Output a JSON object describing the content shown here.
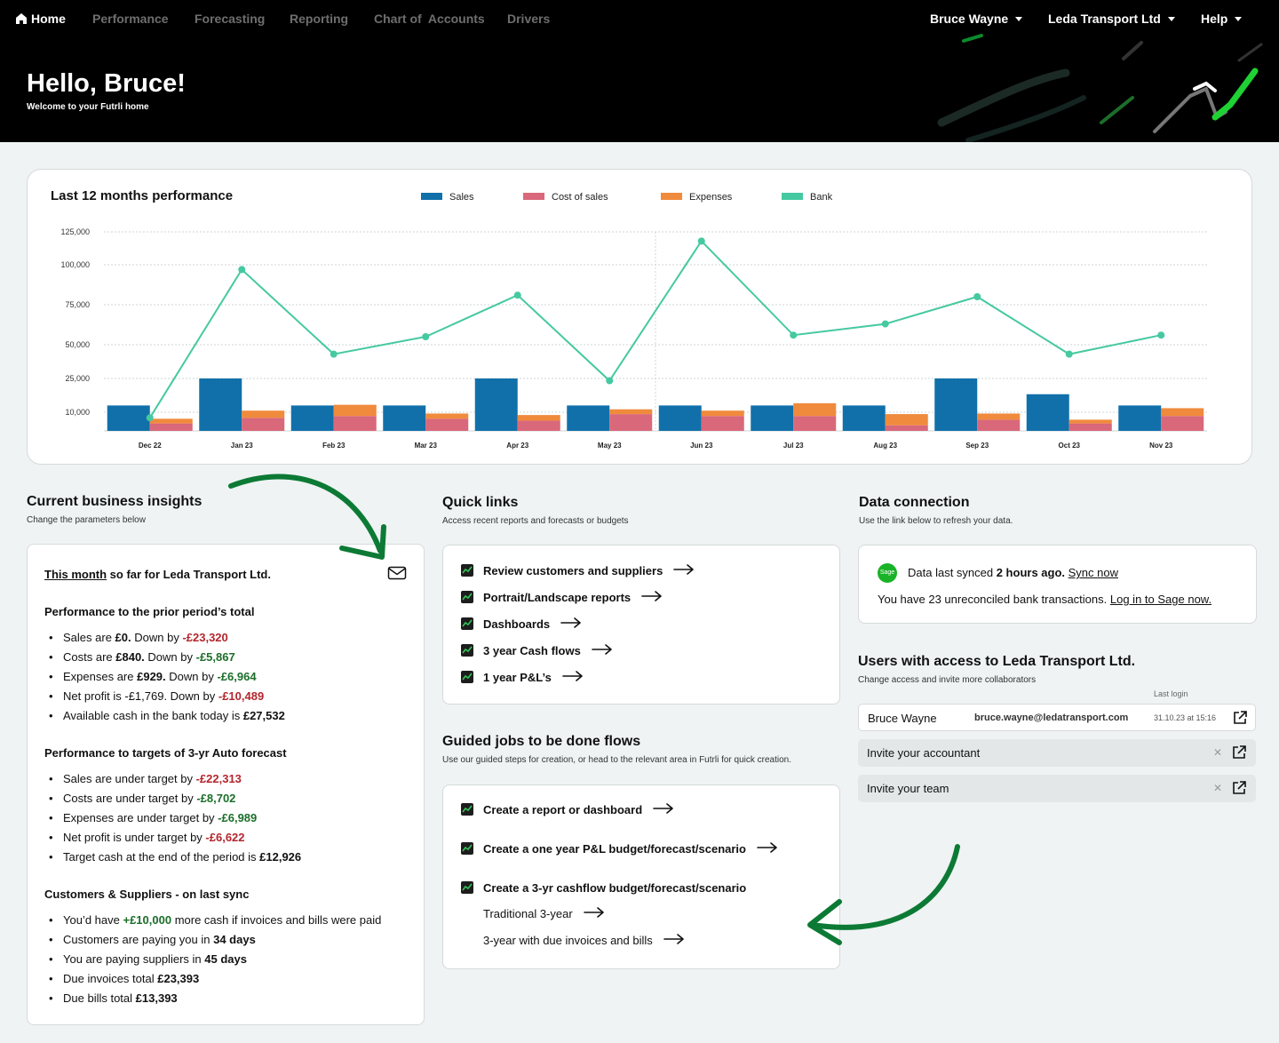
{
  "nav": {
    "home": "Home",
    "items": [
      "Performance",
      "Forecasting",
      "Reporting",
      "Chart of  Accounts",
      "Drivers"
    ],
    "user": "Bruce Wayne",
    "company": "Leda Transport Ltd",
    "help": "Help"
  },
  "hero": {
    "title": "Hello, Bruce!",
    "subtitle": "Welcome to your Futrli home"
  },
  "chart": {
    "title": "Last 12 months performance",
    "legend": [
      "Sales",
      "Cost of sales",
      "Expenses",
      "Bank"
    ],
    "colors": {
      "sales": "#1170aa",
      "cost_of_sales": "#d9687a",
      "expenses": "#f08a3c",
      "bank": "#45c9a0"
    }
  },
  "chart_data": {
    "type": "bar",
    "categories": [
      "Dec 22",
      "Jan 23",
      "Feb 23",
      "Mar 23",
      "Apr 23",
      "May 23",
      "Jun 23",
      "Jul 23",
      "Aug 23",
      "Sep 23",
      "Oct 23",
      "Nov 23"
    ],
    "y_ticks": [
      "125,000",
      "100,000",
      "75,000",
      "50,000",
      "25,000",
      "10,000"
    ],
    "series": [
      {
        "name": "Sales",
        "type": "bar",
        "values": [
          13000,
          25000,
          13000,
          13000,
          25000,
          13000,
          13000,
          13000,
          13000,
          25000,
          18000,
          13000
        ]
      },
      {
        "name": "Cost of sales",
        "type": "stacked-bar",
        "values": [
          4000,
          7000,
          8000,
          6500,
          5500,
          9000,
          8000,
          8000,
          3000,
          6000,
          4000,
          8000
        ]
      },
      {
        "name": "Expenses",
        "type": "stacked-bar",
        "values": [
          2500,
          3700,
          5300,
          2800,
          3000,
          2300,
          2700,
          6000,
          6000,
          3300,
          2000,
          3800
        ]
      },
      {
        "name": "Bank",
        "type": "line",
        "values": [
          7000,
          97000,
          43000,
          55000,
          81000,
          24000,
          118000,
          56000,
          63000,
          80000,
          43000,
          56000
        ]
      }
    ],
    "grid": true,
    "legend_position": "top"
  },
  "insights": {
    "title": "Current business insights",
    "subtitle": "Change the parameters below",
    "head_link": "This month",
    "head_rest": " so far for Leda Transport Ltd.",
    "groups": [
      {
        "title": "Performance to the prior period’s total",
        "items": [
          {
            "pre": "Sales are ",
            "b": "£0.",
            "mid": " Down by ",
            "v": "-£23,320",
            "cls": "neg"
          },
          {
            "pre": "Costs are ",
            "b": "£840.",
            "mid": " Down by ",
            "v": "-£5,867",
            "cls": "pos"
          },
          {
            "pre": "Expenses are ",
            "b": "£929.",
            "mid": " Down by ",
            "v": "-£6,964",
            "cls": "pos"
          },
          {
            "pre": "Net profit is ",
            "b": "",
            "mid": "-£1,769. Down by ",
            "v": "-£10,489",
            "cls": "neg"
          },
          {
            "pre": "Available cash in the bank today is ",
            "b": "£27,532",
            "mid": "",
            "v": "",
            "cls": ""
          }
        ]
      },
      {
        "title": "Performance to targets of 3-yr Auto forecast",
        "items": [
          {
            "pre": "Sales are under target by ",
            "b": "",
            "mid": "",
            "v": "-£22,313",
            "cls": "neg"
          },
          {
            "pre": "Costs are under target by ",
            "b": "",
            "mid": "",
            "v": "-£8,702",
            "cls": "pos"
          },
          {
            "pre": "Expenses are under target by ",
            "b": "",
            "mid": "",
            "v": "-£6,989",
            "cls": "pos"
          },
          {
            "pre": "Net profit is under target by ",
            "b": "",
            "mid": "",
            "v": "-£6,622",
            "cls": "neg"
          },
          {
            "pre": "Target cash at the end of the period is ",
            "b": "£12,926",
            "mid": "",
            "v": "",
            "cls": ""
          }
        ]
      },
      {
        "title": "Customers & Suppliers - on last sync",
        "items": [
          {
            "pre": "You’d have ",
            "b": "",
            "mid": "",
            "v": "+£10,000",
            "cls": "pos",
            "post": " more cash if invoices and bills were paid"
          },
          {
            "pre": "Customers are paying you in ",
            "b": "34 days",
            "mid": "",
            "v": "",
            "cls": ""
          },
          {
            "pre": "You are paying suppliers in ",
            "b": "45 days",
            "mid": "",
            "v": "",
            "cls": ""
          },
          {
            "pre": "Due invoices total ",
            "b": "£23,393",
            "mid": "",
            "v": "",
            "cls": ""
          },
          {
            "pre": "Due bills total ",
            "b": "£13,393",
            "mid": "",
            "v": "",
            "cls": ""
          }
        ]
      }
    ]
  },
  "quick_links": {
    "title": "Quick links",
    "subtitle": "Access recent reports and forecasts or budgets",
    "items": [
      "Review customers and suppliers",
      "Portrait/Landscape reports",
      "Dashboards",
      "3 year Cash flows",
      "1 year P&L’s"
    ]
  },
  "guided": {
    "title": "Guided jobs to be done flows",
    "subtitle": "Use our guided steps for creation, or head to the relevant area in Futrli for quick creation.",
    "items": [
      "Create a report or dashboard",
      "Create a one year P&L budget/forecast/scenario",
      "Create a 3-yr cashflow budget/forecast/scenario"
    ],
    "sub_items": [
      "Traditional 3-year",
      "3-year with due invoices and bills"
    ]
  },
  "data_connection": {
    "title": "Data connection",
    "subtitle": "Use the link below to refresh your data.",
    "badge": "Sage",
    "synced_pre": "Data last synced ",
    "synced_bold": "2 hours ago.",
    "sync_link": "Sync now",
    "unreconciled": "You have 23 unreconciled bank transactions. ",
    "login_link": "Log in to Sage now."
  },
  "users": {
    "title": "Users with access to Leda Transport Ltd.",
    "subtitle": "Change access and invite more collaborators",
    "last_login_label": "Last login",
    "user_name": "Bruce Wayne",
    "user_email": "bruce.wayne@ledatransport.com",
    "user_date": "31.10.23 at 15:16",
    "invite_accountant": "Invite your accountant",
    "invite_team": "Invite your team"
  }
}
